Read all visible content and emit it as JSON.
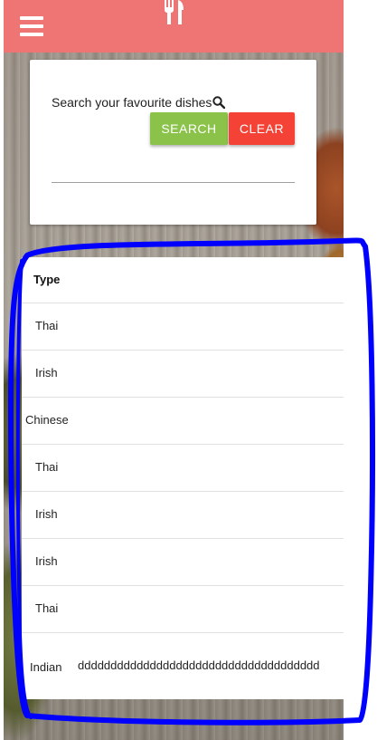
{
  "header": {
    "menu_icon": "hamburger-menu-icon",
    "logo_icon": "fork-knife-icon",
    "color": "#ef7575"
  },
  "search": {
    "label": "Search your favourite dishes",
    "icon": "search-icon",
    "search_button": "SEARCH",
    "clear_button": "CLEAR",
    "input_value": "",
    "search_color": "#8bc34a",
    "clear_color": "#f44336"
  },
  "table": {
    "header": "Type",
    "rows": [
      {
        "type": "Thai"
      },
      {
        "type": "Irish"
      },
      {
        "type": "Chinese"
      },
      {
        "type": "Thai"
      },
      {
        "type": "Irish"
      },
      {
        "type": "Irish"
      },
      {
        "type": "Thai"
      },
      {
        "type": "Indian",
        "description": "ddddddddddddddddddddddddddddddddddddd"
      }
    ]
  },
  "annotation": {
    "color": "#0000ff"
  }
}
